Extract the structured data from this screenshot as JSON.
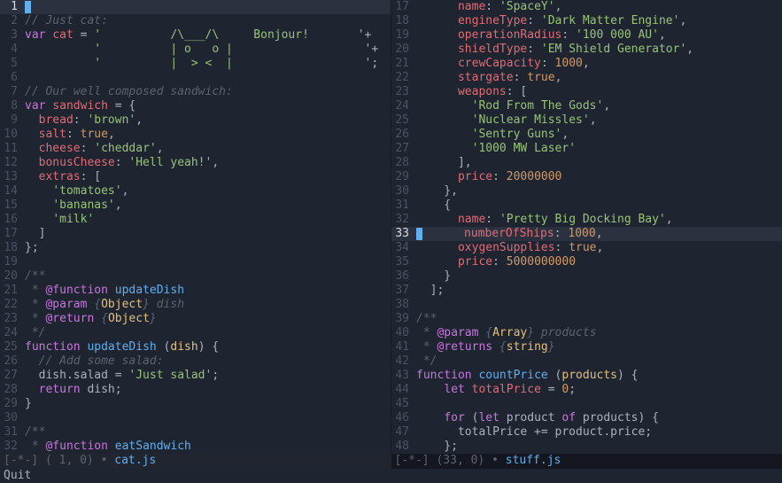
{
  "left": {
    "filename": "cat.js",
    "cursor_pos": "( 1, 0)",
    "status_prefix": "[-*-]",
    "current_line": 1,
    "lines": [
      {
        "n": 1,
        "seg": [
          {
            "t": "",
            "c": "c-plain"
          }
        ],
        "cursor": true
      },
      {
        "n": 2,
        "seg": [
          {
            "t": "// Just cat:",
            "c": "c-comment"
          }
        ]
      },
      {
        "n": 3,
        "seg": [
          {
            "t": "var",
            "c": "c-keyword"
          },
          {
            "t": " ",
            "c": "c-plain"
          },
          {
            "t": "cat",
            "c": "c-var"
          },
          {
            "t": " = ",
            "c": "c-plain"
          },
          {
            "t": "'          /\\___/\\     Bonjour!       '",
            "c": "c-string"
          },
          {
            "t": "+",
            "c": "c-punct"
          }
        ]
      },
      {
        "n": 4,
        "seg": [
          {
            "t": "          ",
            "c": "c-plain"
          },
          {
            "t": "'          | o   o |                   '",
            "c": "c-string"
          },
          {
            "t": "+",
            "c": "c-punct"
          }
        ]
      },
      {
        "n": 5,
        "seg": [
          {
            "t": "          ",
            "c": "c-plain"
          },
          {
            "t": "'          |  > <  |                   '",
            "c": "c-string"
          },
          {
            "t": ";",
            "c": "c-punct"
          }
        ]
      },
      {
        "n": 6,
        "seg": []
      },
      {
        "n": 7,
        "seg": [
          {
            "t": "// Our well composed sandwich:",
            "c": "c-comment"
          }
        ]
      },
      {
        "n": 8,
        "seg": [
          {
            "t": "var",
            "c": "c-keyword"
          },
          {
            "t": " ",
            "c": "c-plain"
          },
          {
            "t": "sandwich",
            "c": "c-var"
          },
          {
            "t": " = {",
            "c": "c-punct"
          }
        ]
      },
      {
        "n": 9,
        "seg": [
          {
            "t": "  ",
            "c": "c-plain"
          },
          {
            "t": "bread",
            "c": "c-prop"
          },
          {
            "t": ": ",
            "c": "c-punct"
          },
          {
            "t": "'brown'",
            "c": "c-string"
          },
          {
            "t": ",",
            "c": "c-punct"
          }
        ]
      },
      {
        "n": 10,
        "seg": [
          {
            "t": "  ",
            "c": "c-plain"
          },
          {
            "t": "salt",
            "c": "c-prop"
          },
          {
            "t": ": ",
            "c": "c-punct"
          },
          {
            "t": "true",
            "c": "c-bool"
          },
          {
            "t": ",",
            "c": "c-punct"
          }
        ]
      },
      {
        "n": 11,
        "seg": [
          {
            "t": "  ",
            "c": "c-plain"
          },
          {
            "t": "cheese",
            "c": "c-prop"
          },
          {
            "t": ": ",
            "c": "c-punct"
          },
          {
            "t": "'cheddar'",
            "c": "c-string"
          },
          {
            "t": ",",
            "c": "c-punct"
          }
        ]
      },
      {
        "n": 12,
        "seg": [
          {
            "t": "  ",
            "c": "c-plain"
          },
          {
            "t": "bonusCheese",
            "c": "c-prop"
          },
          {
            "t": ": ",
            "c": "c-punct"
          },
          {
            "t": "'Hell yeah!'",
            "c": "c-string"
          },
          {
            "t": ",",
            "c": "c-punct"
          }
        ]
      },
      {
        "n": 13,
        "seg": [
          {
            "t": "  ",
            "c": "c-plain"
          },
          {
            "t": "extras",
            "c": "c-prop"
          },
          {
            "t": ": [",
            "c": "c-punct"
          }
        ]
      },
      {
        "n": 14,
        "seg": [
          {
            "t": "    ",
            "c": "c-plain"
          },
          {
            "t": "'tomatoes'",
            "c": "c-string"
          },
          {
            "t": ",",
            "c": "c-punct"
          }
        ]
      },
      {
        "n": 15,
        "seg": [
          {
            "t": "    ",
            "c": "c-plain"
          },
          {
            "t": "'bananas'",
            "c": "c-string"
          },
          {
            "t": ",",
            "c": "c-punct"
          }
        ]
      },
      {
        "n": 16,
        "seg": [
          {
            "t": "    ",
            "c": "c-plain"
          },
          {
            "t": "'milk'",
            "c": "c-string"
          }
        ]
      },
      {
        "n": 17,
        "seg": [
          {
            "t": "  ]",
            "c": "c-punct"
          }
        ]
      },
      {
        "n": 18,
        "seg": [
          {
            "t": "};",
            "c": "c-punct"
          }
        ]
      },
      {
        "n": 19,
        "seg": []
      },
      {
        "n": 20,
        "seg": [
          {
            "t": "/**",
            "c": "c-comment"
          }
        ]
      },
      {
        "n": 21,
        "seg": [
          {
            "t": " * ",
            "c": "c-comment"
          },
          {
            "t": "@function",
            "c": "c-doctag"
          },
          {
            "t": " ",
            "c": "c-comment"
          },
          {
            "t": "updateDish",
            "c": "c-func"
          }
        ]
      },
      {
        "n": 22,
        "seg": [
          {
            "t": " * ",
            "c": "c-comment"
          },
          {
            "t": "@param",
            "c": "c-doctag"
          },
          {
            "t": " {",
            "c": "c-comment"
          },
          {
            "t": "Object",
            "c": "c-doctype"
          },
          {
            "t": "} dish",
            "c": "c-comment"
          }
        ]
      },
      {
        "n": 23,
        "seg": [
          {
            "t": " * ",
            "c": "c-comment"
          },
          {
            "t": "@return",
            "c": "c-doctag"
          },
          {
            "t": " {",
            "c": "c-comment"
          },
          {
            "t": "Object",
            "c": "c-doctype"
          },
          {
            "t": "}",
            "c": "c-comment"
          }
        ]
      },
      {
        "n": 24,
        "seg": [
          {
            "t": " */",
            "c": "c-comment"
          }
        ]
      },
      {
        "n": 25,
        "seg": [
          {
            "t": "function",
            "c": "c-keyword"
          },
          {
            "t": " ",
            "c": "c-plain"
          },
          {
            "t": "updateDish",
            "c": "c-func"
          },
          {
            "t": " (",
            "c": "c-punct"
          },
          {
            "t": "dish",
            "c": "c-param"
          },
          {
            "t": ") {",
            "c": "c-punct"
          }
        ]
      },
      {
        "n": 26,
        "seg": [
          {
            "t": "  ",
            "c": "c-plain"
          },
          {
            "t": "// Add some salad:",
            "c": "c-comment"
          }
        ]
      },
      {
        "n": 27,
        "seg": [
          {
            "t": "  dish.salad = ",
            "c": "c-plain"
          },
          {
            "t": "'Just salad'",
            "c": "c-string"
          },
          {
            "t": ";",
            "c": "c-punct"
          }
        ]
      },
      {
        "n": 28,
        "seg": [
          {
            "t": "  ",
            "c": "c-plain"
          },
          {
            "t": "return",
            "c": "c-keyword"
          },
          {
            "t": " dish;",
            "c": "c-plain"
          }
        ]
      },
      {
        "n": 29,
        "seg": [
          {
            "t": "}",
            "c": "c-punct"
          }
        ]
      },
      {
        "n": 30,
        "seg": []
      },
      {
        "n": 31,
        "seg": [
          {
            "t": "/**",
            "c": "c-comment"
          }
        ]
      },
      {
        "n": 32,
        "seg": [
          {
            "t": " * ",
            "c": "c-comment"
          },
          {
            "t": "@function",
            "c": "c-doctag"
          },
          {
            "t": " ",
            "c": "c-comment"
          },
          {
            "t": "eatSandwich",
            "c": "c-func"
          }
        ]
      }
    ]
  },
  "right": {
    "filename": "stuff.js",
    "cursor_pos": "(33, 0)",
    "status_prefix": "[-*-]",
    "current_line": 33,
    "lines": [
      {
        "n": 17,
        "seg": [
          {
            "t": "      ",
            "c": "c-plain"
          },
          {
            "t": "name",
            "c": "c-prop"
          },
          {
            "t": ": ",
            "c": "c-punct"
          },
          {
            "t": "'SpaceY'",
            "c": "c-string"
          },
          {
            "t": ",",
            "c": "c-punct"
          }
        ]
      },
      {
        "n": 18,
        "seg": [
          {
            "t": "      ",
            "c": "c-plain"
          },
          {
            "t": "engineType",
            "c": "c-prop"
          },
          {
            "t": ": ",
            "c": "c-punct"
          },
          {
            "t": "'Dark Matter Engine'",
            "c": "c-string"
          },
          {
            "t": ",",
            "c": "c-punct"
          }
        ]
      },
      {
        "n": 19,
        "seg": [
          {
            "t": "      ",
            "c": "c-plain"
          },
          {
            "t": "operationRadius",
            "c": "c-prop"
          },
          {
            "t": ": ",
            "c": "c-punct"
          },
          {
            "t": "'100 000 AU'",
            "c": "c-string"
          },
          {
            "t": ",",
            "c": "c-punct"
          }
        ]
      },
      {
        "n": 20,
        "seg": [
          {
            "t": "      ",
            "c": "c-plain"
          },
          {
            "t": "shieldType",
            "c": "c-prop"
          },
          {
            "t": ": ",
            "c": "c-punct"
          },
          {
            "t": "'EM Shield Generator'",
            "c": "c-string"
          },
          {
            "t": ",",
            "c": "c-punct"
          }
        ]
      },
      {
        "n": 21,
        "seg": [
          {
            "t": "      ",
            "c": "c-plain"
          },
          {
            "t": "crewCapacity",
            "c": "c-prop"
          },
          {
            "t": ": ",
            "c": "c-punct"
          },
          {
            "t": "1000",
            "c": "c-num"
          },
          {
            "t": ",",
            "c": "c-punct"
          }
        ]
      },
      {
        "n": 22,
        "seg": [
          {
            "t": "      ",
            "c": "c-plain"
          },
          {
            "t": "stargate",
            "c": "c-prop"
          },
          {
            "t": ": ",
            "c": "c-punct"
          },
          {
            "t": "true",
            "c": "c-bool"
          },
          {
            "t": ",",
            "c": "c-punct"
          }
        ]
      },
      {
        "n": 23,
        "seg": [
          {
            "t": "      ",
            "c": "c-plain"
          },
          {
            "t": "weapons",
            "c": "c-prop"
          },
          {
            "t": ": [",
            "c": "c-punct"
          }
        ]
      },
      {
        "n": 24,
        "seg": [
          {
            "t": "        ",
            "c": "c-plain"
          },
          {
            "t": "'Rod From The Gods'",
            "c": "c-string"
          },
          {
            "t": ",",
            "c": "c-punct"
          }
        ]
      },
      {
        "n": 25,
        "seg": [
          {
            "t": "        ",
            "c": "c-plain"
          },
          {
            "t": "'Nuclear Missles'",
            "c": "c-string"
          },
          {
            "t": ",",
            "c": "c-punct"
          }
        ]
      },
      {
        "n": 26,
        "seg": [
          {
            "t": "        ",
            "c": "c-plain"
          },
          {
            "t": "'Sentry Guns'",
            "c": "c-string"
          },
          {
            "t": ",",
            "c": "c-punct"
          }
        ]
      },
      {
        "n": 27,
        "seg": [
          {
            "t": "        ",
            "c": "c-plain"
          },
          {
            "t": "'1000 MW Laser'",
            "c": "c-string"
          }
        ]
      },
      {
        "n": 28,
        "seg": [
          {
            "t": "      ],",
            "c": "c-punct"
          }
        ]
      },
      {
        "n": 29,
        "seg": [
          {
            "t": "      ",
            "c": "c-plain"
          },
          {
            "t": "price",
            "c": "c-prop"
          },
          {
            "t": ": ",
            "c": "c-punct"
          },
          {
            "t": "20000000",
            "c": "c-num"
          }
        ]
      },
      {
        "n": 30,
        "seg": [
          {
            "t": "    },",
            "c": "c-punct"
          }
        ]
      },
      {
        "n": 31,
        "seg": [
          {
            "t": "    {",
            "c": "c-punct"
          }
        ]
      },
      {
        "n": 32,
        "seg": [
          {
            "t": "      ",
            "c": "c-plain"
          },
          {
            "t": "name",
            "c": "c-prop"
          },
          {
            "t": ": ",
            "c": "c-punct"
          },
          {
            "t": "'Pretty Big Docking Bay'",
            "c": "c-string"
          },
          {
            "t": ",",
            "c": "c-punct"
          }
        ]
      },
      {
        "n": 33,
        "seg": [
          {
            "t": "      ",
            "c": "c-plain"
          },
          {
            "t": "numberOfShips",
            "c": "c-prop"
          },
          {
            "t": ": ",
            "c": "c-punct"
          },
          {
            "t": "1000",
            "c": "c-num"
          },
          {
            "t": ",",
            "c": "c-punct"
          }
        ],
        "cursor": true
      },
      {
        "n": 34,
        "seg": [
          {
            "t": "      ",
            "c": "c-plain"
          },
          {
            "t": "oxygenSupplies",
            "c": "c-prop"
          },
          {
            "t": ": ",
            "c": "c-punct"
          },
          {
            "t": "true",
            "c": "c-bool"
          },
          {
            "t": ",",
            "c": "c-punct"
          }
        ]
      },
      {
        "n": 35,
        "seg": [
          {
            "t": "      ",
            "c": "c-plain"
          },
          {
            "t": "price",
            "c": "c-prop"
          },
          {
            "t": ": ",
            "c": "c-punct"
          },
          {
            "t": "5000000000",
            "c": "c-num"
          }
        ]
      },
      {
        "n": 36,
        "seg": [
          {
            "t": "    }",
            "c": "c-punct"
          }
        ]
      },
      {
        "n": 37,
        "seg": [
          {
            "t": "  ];",
            "c": "c-punct"
          }
        ]
      },
      {
        "n": 38,
        "seg": []
      },
      {
        "n": 39,
        "seg": [
          {
            "t": "/**",
            "c": "c-comment"
          }
        ]
      },
      {
        "n": 40,
        "seg": [
          {
            "t": " * ",
            "c": "c-comment"
          },
          {
            "t": "@param",
            "c": "c-doctag"
          },
          {
            "t": " {",
            "c": "c-comment"
          },
          {
            "t": "Array",
            "c": "c-doctype"
          },
          {
            "t": "} products",
            "c": "c-comment"
          }
        ]
      },
      {
        "n": 41,
        "seg": [
          {
            "t": " * ",
            "c": "c-comment"
          },
          {
            "t": "@returns",
            "c": "c-doctag"
          },
          {
            "t": " {",
            "c": "c-comment"
          },
          {
            "t": "string",
            "c": "c-doctype"
          },
          {
            "t": "}",
            "c": "c-comment"
          }
        ]
      },
      {
        "n": 42,
        "seg": [
          {
            "t": " */",
            "c": "c-comment"
          }
        ]
      },
      {
        "n": 43,
        "seg": [
          {
            "t": "function",
            "c": "c-keyword"
          },
          {
            "t": " ",
            "c": "c-plain"
          },
          {
            "t": "countPrice",
            "c": "c-func"
          },
          {
            "t": " (",
            "c": "c-punct"
          },
          {
            "t": "products",
            "c": "c-param"
          },
          {
            "t": ") {",
            "c": "c-punct"
          }
        ]
      },
      {
        "n": 44,
        "seg": [
          {
            "t": "    ",
            "c": "c-plain"
          },
          {
            "t": "let",
            "c": "c-keyword"
          },
          {
            "t": " ",
            "c": "c-plain"
          },
          {
            "t": "totalPrice",
            "c": "c-var"
          },
          {
            "t": " = ",
            "c": "c-plain"
          },
          {
            "t": "0",
            "c": "c-num"
          },
          {
            "t": ";",
            "c": "c-punct"
          }
        ]
      },
      {
        "n": 45,
        "seg": []
      },
      {
        "n": 46,
        "seg": [
          {
            "t": "    ",
            "c": "c-plain"
          },
          {
            "t": "for",
            "c": "c-keyword"
          },
          {
            "t": " (",
            "c": "c-punct"
          },
          {
            "t": "let",
            "c": "c-keyword"
          },
          {
            "t": " product ",
            "c": "c-plain"
          },
          {
            "t": "of",
            "c": "c-keyword"
          },
          {
            "t": " products) {",
            "c": "c-plain"
          }
        ]
      },
      {
        "n": 47,
        "seg": [
          {
            "t": "      totalPrice += product.price;",
            "c": "c-plain"
          }
        ]
      },
      {
        "n": 48,
        "seg": [
          {
            "t": "    };",
            "c": "c-punct"
          }
        ]
      }
    ]
  },
  "footer": "Quit"
}
